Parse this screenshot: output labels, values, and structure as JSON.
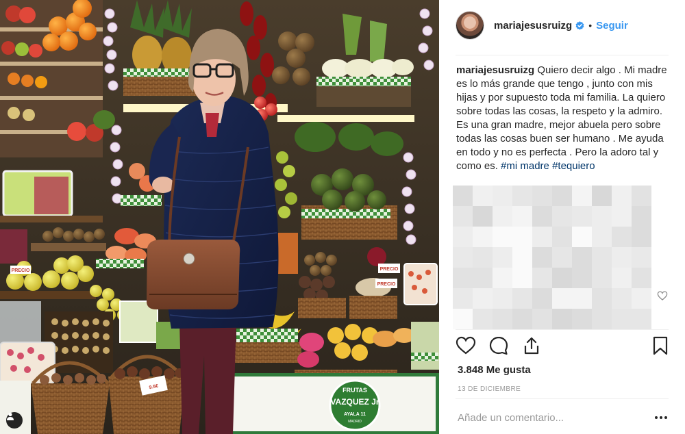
{
  "post": {
    "username": "mariajesusruizg",
    "follow_label": "Seguir",
    "dot": "•",
    "caption_user": "mariajesusruizg",
    "caption_text": " Quiero decir algo . Mi madre es lo más grande que tengo , junto con mis hijas y por supuesto toda mi familia. La quiero sobre todas las cosas, la respeto y la admiro. Es una gran madre, mejor abuela pero sobre todas las cosas buen ser humano . Me ayuda en todo y no es perfecta . Pero la adoro tal y como es. ",
    "tags": [
      "#mi madre",
      "#tequiero"
    ],
    "likes": "3.848 Me gusta",
    "date": "13 DE DICIEMBRE",
    "comment_placeholder": "Añade un comentario..."
  },
  "photo": {
    "sign_line1": "FRUTAS",
    "sign_line2": "VAZQUEZ Jr",
    "sign_line3": "AYALA 11",
    "sign_line4": "MADRID",
    "price_tag": "9.5€",
    "price_tag2": "PRECIO",
    "price_tag3": "PRECIO",
    "price_tag4": "PRECIO"
  },
  "icons": {
    "verified": "verified-badge-icon",
    "like": "heart-icon",
    "comment": "comment-icon",
    "share": "share-icon",
    "save": "bookmark-icon",
    "comment_like": "small-heart-icon",
    "more": "more-options-icon",
    "user_tag": "user-tag-icon"
  },
  "colors": {
    "link_blue": "#3897f0",
    "hashtag": "#003569",
    "text": "#262626",
    "muted": "#999999"
  }
}
